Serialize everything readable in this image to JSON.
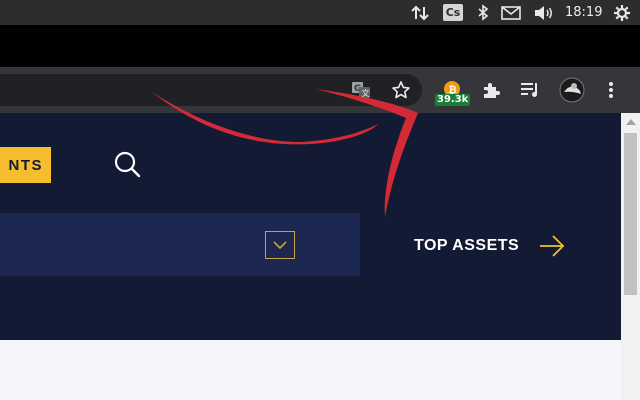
{
  "system_panel": {
    "clock": "18:19",
    "cs_label": "Cs",
    "icons": [
      "network-transfer-icon",
      "cs-app-icon",
      "bluetooth-icon",
      "mail-icon",
      "volume-icon",
      "settings-cog-icon"
    ]
  },
  "browser": {
    "toolbar_icons": [
      "translate-icon",
      "bookmark-star-icon",
      "extension-coin-icon",
      "puzzle-extensions-icon",
      "media-queue-icon",
      "profile-avatar-icon",
      "more-menu-icon"
    ],
    "extension_badge": "39.3k",
    "badge_color": "#188038"
  },
  "site": {
    "events_button_visible_text": "NTS",
    "top_assets_label": "TOP ASSETS",
    "colors": {
      "header_bg": "#131a33",
      "accent_yellow": "#f6be2e",
      "select_bg": "#1b2750"
    }
  },
  "annotation": {
    "type": "red-curved-arrow",
    "color": "#d42a35"
  }
}
